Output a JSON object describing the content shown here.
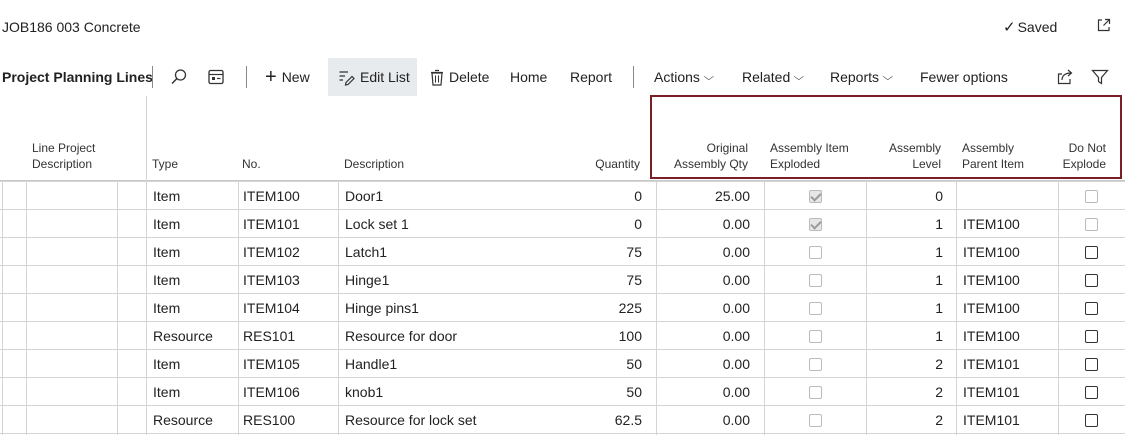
{
  "page": {
    "title": "JOB186 003 Concrete",
    "saved_label": "Saved"
  },
  "action_bar": {
    "section_title": "Project Planning Lines",
    "new_label": "New",
    "edit_list_label": "Edit List",
    "delete_label": "Delete",
    "home_label": "Home",
    "report_label": "Report",
    "actions_label": "Actions",
    "related_label": "Related",
    "reports_label": "Reports",
    "fewer_options_label": "Fewer options"
  },
  "columns": {
    "line_project_description": [
      "Line Project",
      "Description"
    ],
    "type": "Type",
    "no": "No.",
    "description": "Description",
    "quantity": "Quantity",
    "original_assembly_qty": [
      "Original",
      "Assembly Qty"
    ],
    "assembly_item_exploded": [
      "Assembly Item",
      "Exploded"
    ],
    "assembly_level": [
      "Assembly",
      "Level"
    ],
    "assembly_parent_item": [
      "Assembly",
      "Parent Item"
    ],
    "do_not_explode": [
      "Do Not",
      "Explode"
    ]
  },
  "rows": [
    {
      "type": "Item",
      "no": "ITEM100",
      "description": "Door1",
      "quantity": "0",
      "original_assembly_qty": "25.00",
      "assembly_item_exploded": true,
      "exploded_disabled": true,
      "assembly_level": "0",
      "assembly_parent_item": "",
      "do_not_explode": false,
      "do_not_explode_disabled": true
    },
    {
      "type": "Item",
      "no": "ITEM101",
      "description": "Lock set 1",
      "quantity": "0",
      "original_assembly_qty": "0.00",
      "assembly_item_exploded": true,
      "exploded_disabled": true,
      "assembly_level": "1",
      "assembly_parent_item": "ITEM100",
      "do_not_explode": false,
      "do_not_explode_disabled": true
    },
    {
      "type": "Item",
      "no": "ITEM102",
      "description": "Latch1",
      "quantity": "75",
      "original_assembly_qty": "0.00",
      "assembly_item_exploded": false,
      "exploded_disabled": true,
      "assembly_level": "1",
      "assembly_parent_item": "ITEM100",
      "do_not_explode": false,
      "do_not_explode_disabled": false
    },
    {
      "type": "Item",
      "no": "ITEM103",
      "description": "Hinge1",
      "quantity": "75",
      "original_assembly_qty": "0.00",
      "assembly_item_exploded": false,
      "exploded_disabled": true,
      "assembly_level": "1",
      "assembly_parent_item": "ITEM100",
      "do_not_explode": false,
      "do_not_explode_disabled": false
    },
    {
      "type": "Item",
      "no": "ITEM104",
      "description": "Hinge pins1",
      "quantity": "225",
      "original_assembly_qty": "0.00",
      "assembly_item_exploded": false,
      "exploded_disabled": true,
      "assembly_level": "1",
      "assembly_parent_item": "ITEM100",
      "do_not_explode": false,
      "do_not_explode_disabled": false
    },
    {
      "type": "Resource",
      "no": "RES101",
      "description": "Resource for door",
      "quantity": "100",
      "original_assembly_qty": "0.00",
      "assembly_item_exploded": false,
      "exploded_disabled": true,
      "assembly_level": "1",
      "assembly_parent_item": "ITEM100",
      "do_not_explode": false,
      "do_not_explode_disabled": false
    },
    {
      "type": "Item",
      "no": "ITEM105",
      "description": "Handle1",
      "quantity": "50",
      "original_assembly_qty": "0.00",
      "assembly_item_exploded": false,
      "exploded_disabled": true,
      "assembly_level": "2",
      "assembly_parent_item": "ITEM101",
      "do_not_explode": false,
      "do_not_explode_disabled": false
    },
    {
      "type": "Item",
      "no": "ITEM106",
      "description": "knob1",
      "quantity": "50",
      "original_assembly_qty": "0.00",
      "assembly_item_exploded": false,
      "exploded_disabled": true,
      "assembly_level": "2",
      "assembly_parent_item": "ITEM101",
      "do_not_explode": false,
      "do_not_explode_disabled": false
    },
    {
      "type": "Resource",
      "no": "RES100",
      "description": "Resource for lock set",
      "quantity": "62.5",
      "original_assembly_qty": "0.00",
      "assembly_item_exploded": false,
      "exploded_disabled": true,
      "assembly_level": "2",
      "assembly_parent_item": "ITEM101",
      "do_not_explode": false,
      "do_not_explode_disabled": false
    }
  ],
  "colors": {
    "highlight_border": "#7a1f25",
    "active_button_bg": "#e8ebed",
    "grid_line": "#d4d4d4"
  }
}
